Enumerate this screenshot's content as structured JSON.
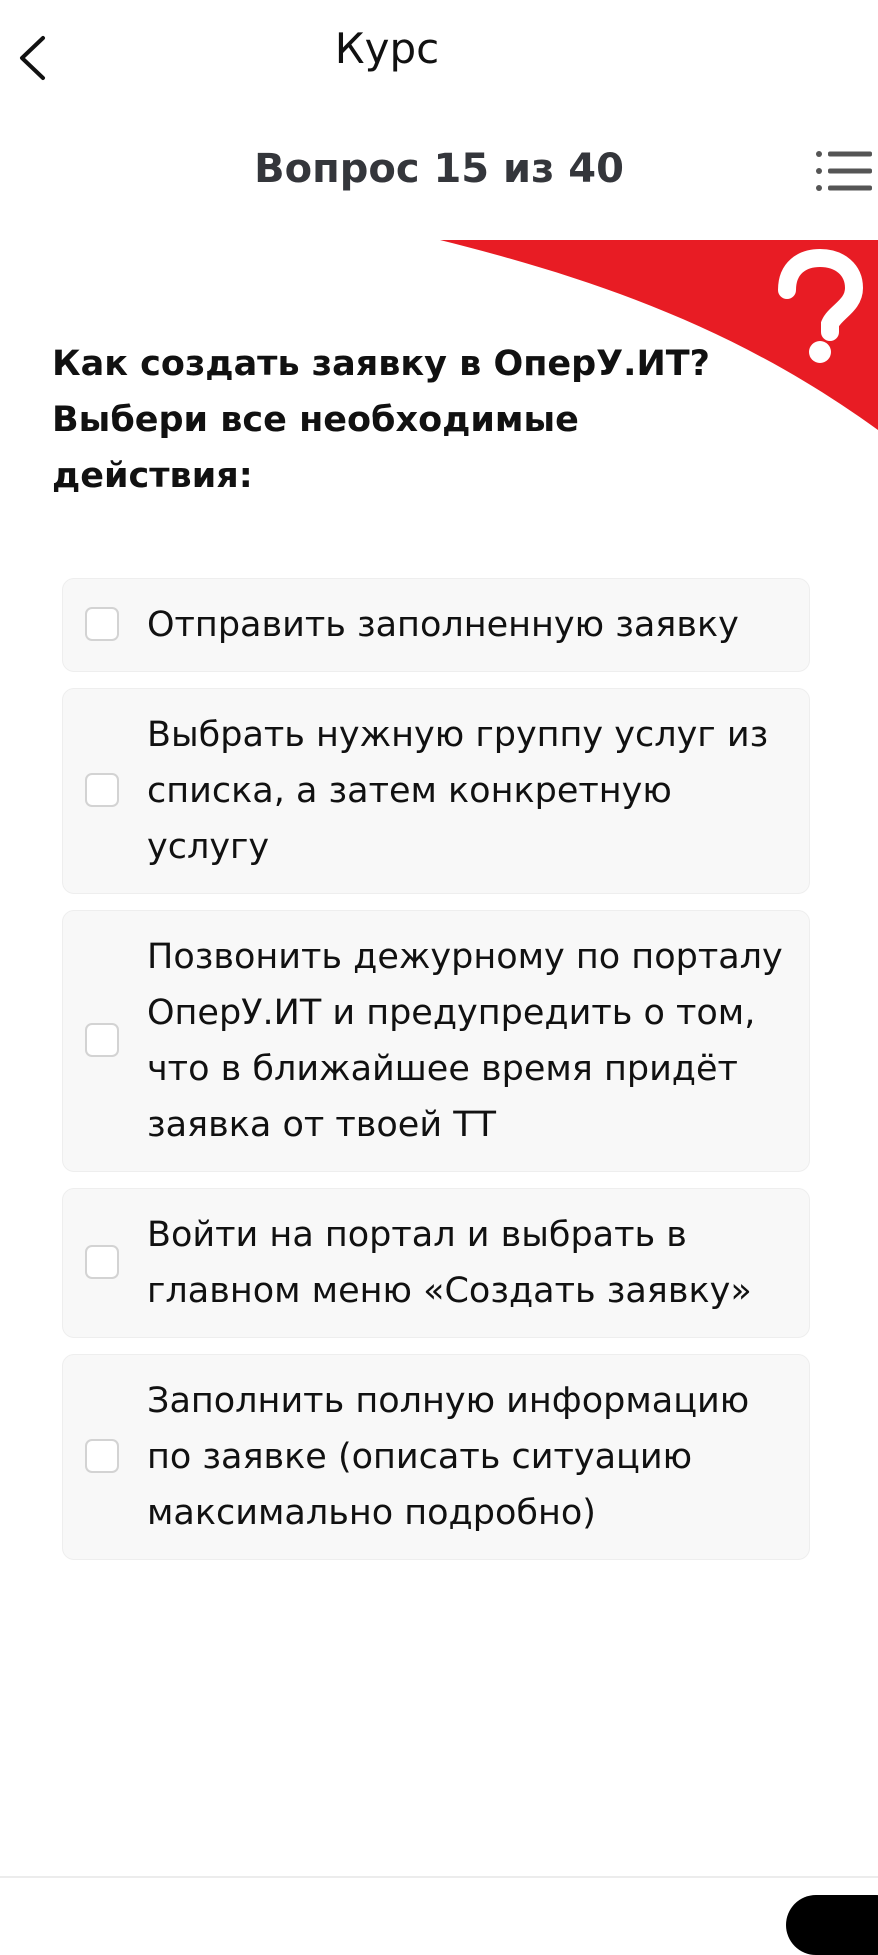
{
  "header": {
    "title": "Курс",
    "back_icon": "chevron-left-icon"
  },
  "quiz": {
    "progress": "Вопрос 15 из 40",
    "menu_icon": "list-menu-icon",
    "banner_icon": "question-mark-icon",
    "accent_color": "#e81c24",
    "question": "Как создать заявку в ОперУ.ИТ? Выбери все необходимые действия:",
    "options": [
      {
        "text": "Отправить заполненную заявку",
        "checked": false
      },
      {
        "text": "Выбрать нужную группу услуг из списка, а затем конкретную услугу",
        "checked": false
      },
      {
        "text": "Позвонить дежурному по порталу ОперУ.ИТ и предупредить о том, что в ближайшее время придёт заявка от твоей ТТ",
        "checked": false
      },
      {
        "text": "Войти на портал и выбрать в главном меню «Создать заявку»",
        "checked": false
      },
      {
        "text": "Заполнить полную информацию по заявке (описать ситуацию максимально подробно)",
        "checked": false
      }
    ]
  }
}
